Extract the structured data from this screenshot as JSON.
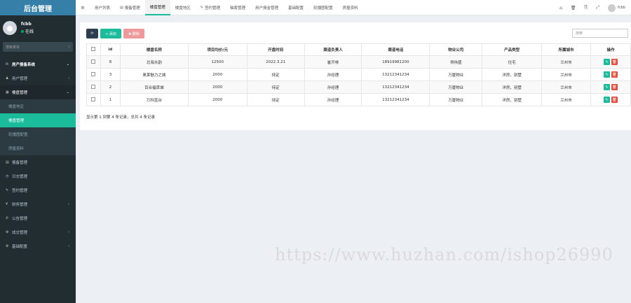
{
  "sidebar": {
    "brand": "后台管理",
    "user": {
      "name": "fcbb",
      "status": "在线"
    },
    "search_placeholder": "搜索菜单",
    "items": [
      {
        "icon": "comments-icon",
        "glyph": "✉",
        "label": "房产报备系统",
        "arrow": "⌄",
        "kind": "header-item"
      },
      {
        "icon": "user-icon",
        "glyph": "♟",
        "label": "用户管理",
        "arrow": "‹",
        "kind": ""
      },
      {
        "icon": "building-icon",
        "glyph": "▦",
        "label": "楼盘管理",
        "arrow": "⌄",
        "kind": "open"
      }
    ],
    "sub_items": [
      {
        "label": "楼盘地区",
        "active": false
      },
      {
        "label": "楼盘管理",
        "active": true
      },
      {
        "label": "轮播图配置",
        "active": false
      },
      {
        "label": "房屋资料",
        "active": false
      }
    ],
    "items_after": [
      {
        "icon": "report-icon",
        "glyph": "▤",
        "label": "报备管理",
        "arrow": ""
      },
      {
        "icon": "clock-icon",
        "glyph": "◷",
        "label": "日志管理",
        "arrow": ""
      },
      {
        "icon": "sign-icon",
        "glyph": "✎",
        "label": "签约管理",
        "arrow": ""
      },
      {
        "icon": "money-icon",
        "glyph": "¥",
        "label": "财务管理",
        "arrow": "‹"
      },
      {
        "icon": "notice-icon",
        "glyph": "✆",
        "label": "公告管理",
        "arrow": ""
      },
      {
        "icon": "deal-icon",
        "glyph": "⚙",
        "label": "成交管理",
        "arrow": "‹"
      },
      {
        "icon": "gear-icon",
        "glyph": "⚙",
        "label": "基础配置",
        "arrow": "‹"
      }
    ]
  },
  "topbar": {
    "tabs": [
      {
        "label": "用户列表",
        "glyph": "",
        "active": false
      },
      {
        "label": "报备管理",
        "glyph": "▤",
        "active": false
      },
      {
        "label": "楼盘管理",
        "glyph": "",
        "active": true
      },
      {
        "label": "楼盘地区",
        "glyph": "",
        "active": false
      },
      {
        "label": "签约管理",
        "glyph": "✎",
        "active": false
      },
      {
        "label": "轴套管理",
        "glyph": "",
        "active": false
      },
      {
        "label": "用户佣金管理",
        "glyph": "",
        "active": false
      },
      {
        "label": "基础配置",
        "glyph": "",
        "active": false
      },
      {
        "label": "轮播图配置",
        "glyph": "",
        "active": false
      },
      {
        "label": "房屋资料",
        "glyph": "",
        "active": false
      }
    ],
    "user_label": "fcbb"
  },
  "toolbar": {
    "refresh_glyph": "⟳",
    "add_label": "+ 添加",
    "delete_label": "✖ 删除",
    "search_placeholder": "搜索"
  },
  "table": {
    "headers": [
      "",
      "id",
      "楼盘名称",
      "项目均价/元",
      "开盘时间",
      "渠道负责人",
      "渠道电话",
      "物业公司",
      "产品类型",
      "所属城市",
      "操作"
    ],
    "rows": [
      [
        "8",
        "北海水韵",
        "12500",
        "2022.3.21",
        "崔开林",
        "18919981200",
        "得伟盛",
        "住宅",
        "兰州市"
      ],
      [
        "3",
        "奥莱魅力之城",
        "2000",
        "待定",
        "孙经理",
        "13212341234",
        "万厦物业",
        "洋房，别墅",
        "兰州市"
      ],
      [
        "2",
        "百合福草城",
        "2000",
        "待定",
        "孙经理",
        "13212341234",
        "万厦物业",
        "洋房，别墅",
        "兰州市"
      ],
      [
        "1",
        "万科蓝台",
        "2000",
        "待定",
        "孙经理",
        "13212341234",
        "万厦物业",
        "洋房，别墅",
        "兰州市"
      ]
    ]
  },
  "page_info": "显示第 1 到第 4 条记录，总共 4 条记录",
  "watermark": "https://www.huzhan.com/ishop26990"
}
